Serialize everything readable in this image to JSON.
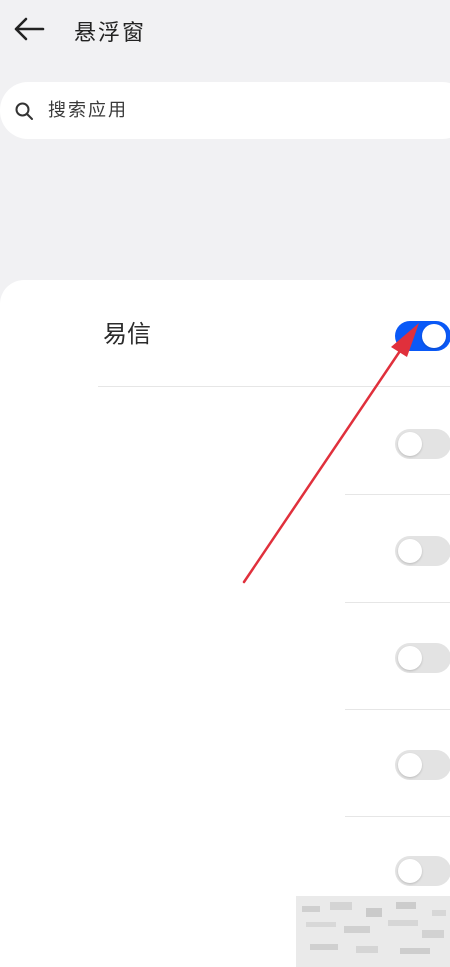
{
  "header": {
    "title": "悬浮窗",
    "back_icon": "arrow-left-icon"
  },
  "search": {
    "placeholder": "搜索应用",
    "value": "",
    "icon": "search-icon"
  },
  "apps": [
    {
      "name": "易信",
      "enabled": true
    },
    {
      "name": "",
      "enabled": false
    },
    {
      "name": "",
      "enabled": false
    },
    {
      "name": "",
      "enabled": false
    },
    {
      "name": "",
      "enabled": false
    },
    {
      "name": "",
      "enabled": false
    }
  ],
  "colors": {
    "background": "#f1f1f3",
    "card": "#ffffff",
    "toggle_on": "#0a59f7",
    "toggle_off": "#e3e3e3",
    "annotation_arrow": "#e0303c"
  }
}
